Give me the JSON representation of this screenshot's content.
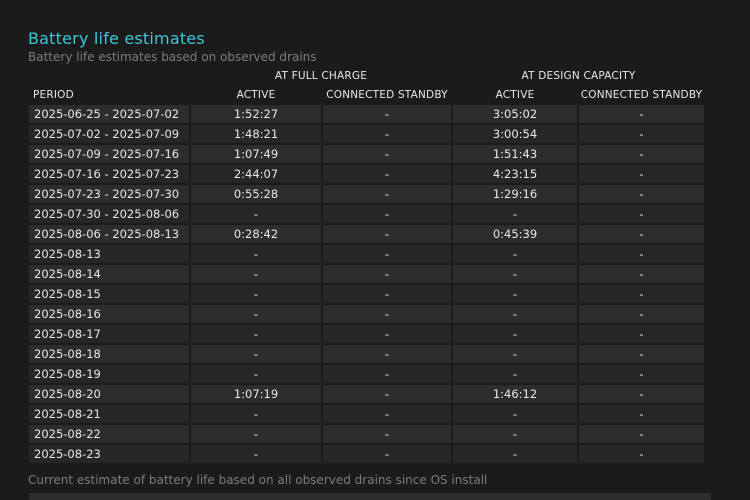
{
  "header": {
    "title": "Battery life estimates",
    "subtitle": "Battery life estimates based on observed drains"
  },
  "table": {
    "group_full": "AT FULL CHARGE",
    "group_design": "AT DESIGN CAPACITY",
    "col_period": "PERIOD",
    "col_active_full": "ACTIVE",
    "col_standby_full": "CONNECTED STANDBY",
    "col_active_design": "ACTIVE",
    "col_standby_design": "CONNECTED STANDBY",
    "rows": [
      {
        "period": "2025-06-25 - 2025-07-02",
        "active_full": "1:52:27",
        "standby_full": "-",
        "active_design": "3:05:02",
        "standby_design": "-"
      },
      {
        "period": "2025-07-02 - 2025-07-09",
        "active_full": "1:48:21",
        "standby_full": "-",
        "active_design": "3:00:54",
        "standby_design": "-"
      },
      {
        "period": "2025-07-09 - 2025-07-16",
        "active_full": "1:07:49",
        "standby_full": "-",
        "active_design": "1:51:43",
        "standby_design": "-"
      },
      {
        "period": "2025-07-16 - 2025-07-23",
        "active_full": "2:44:07",
        "standby_full": "-",
        "active_design": "4:23:15",
        "standby_design": "-"
      },
      {
        "period": "2025-07-23 - 2025-07-30",
        "active_full": "0:55:28",
        "standby_full": "-",
        "active_design": "1:29:16",
        "standby_design": "-"
      },
      {
        "period": "2025-07-30 - 2025-08-06",
        "active_full": "-",
        "standby_full": "-",
        "active_design": "-",
        "standby_design": "-"
      },
      {
        "period": "2025-08-06 - 2025-08-13",
        "active_full": "0:28:42",
        "standby_full": "-",
        "active_design": "0:45:39",
        "standby_design": "-"
      },
      {
        "period": "2025-08-13",
        "active_full": "-",
        "standby_full": "-",
        "active_design": "-",
        "standby_design": "-"
      },
      {
        "period": "2025-08-14",
        "active_full": "-",
        "standby_full": "-",
        "active_design": "-",
        "standby_design": "-"
      },
      {
        "period": "2025-08-15",
        "active_full": "-",
        "standby_full": "-",
        "active_design": "-",
        "standby_design": "-"
      },
      {
        "period": "2025-08-16",
        "active_full": "-",
        "standby_full": "-",
        "active_design": "-",
        "standby_design": "-"
      },
      {
        "period": "2025-08-17",
        "active_full": "-",
        "standby_full": "-",
        "active_design": "-",
        "standby_design": "-"
      },
      {
        "period": "2025-08-18",
        "active_full": "-",
        "standby_full": "-",
        "active_design": "-",
        "standby_design": "-"
      },
      {
        "period": "2025-08-19",
        "active_full": "-",
        "standby_full": "-",
        "active_design": "-",
        "standby_design": "-"
      },
      {
        "period": "2025-08-20",
        "active_full": "1:07:19",
        "standby_full": "-",
        "active_design": "1:46:12",
        "standby_design": "-"
      },
      {
        "period": "2025-08-21",
        "active_full": "-",
        "standby_full": "-",
        "active_design": "-",
        "standby_design": "-"
      },
      {
        "period": "2025-08-22",
        "active_full": "-",
        "standby_full": "-",
        "active_design": "-",
        "standby_design": "-"
      },
      {
        "period": "2025-08-23",
        "active_full": "-",
        "standby_full": "-",
        "active_design": "-",
        "standby_design": "-"
      }
    ]
  },
  "footnote": "Current estimate of battery life based on all observed drains since OS install",
  "colors": {
    "background": "#1b1b1b",
    "title_accent": "#3cc8d8",
    "row_odd": "#2d2d2d",
    "row_even": "#262626",
    "muted_text": "#7c7c7c"
  }
}
